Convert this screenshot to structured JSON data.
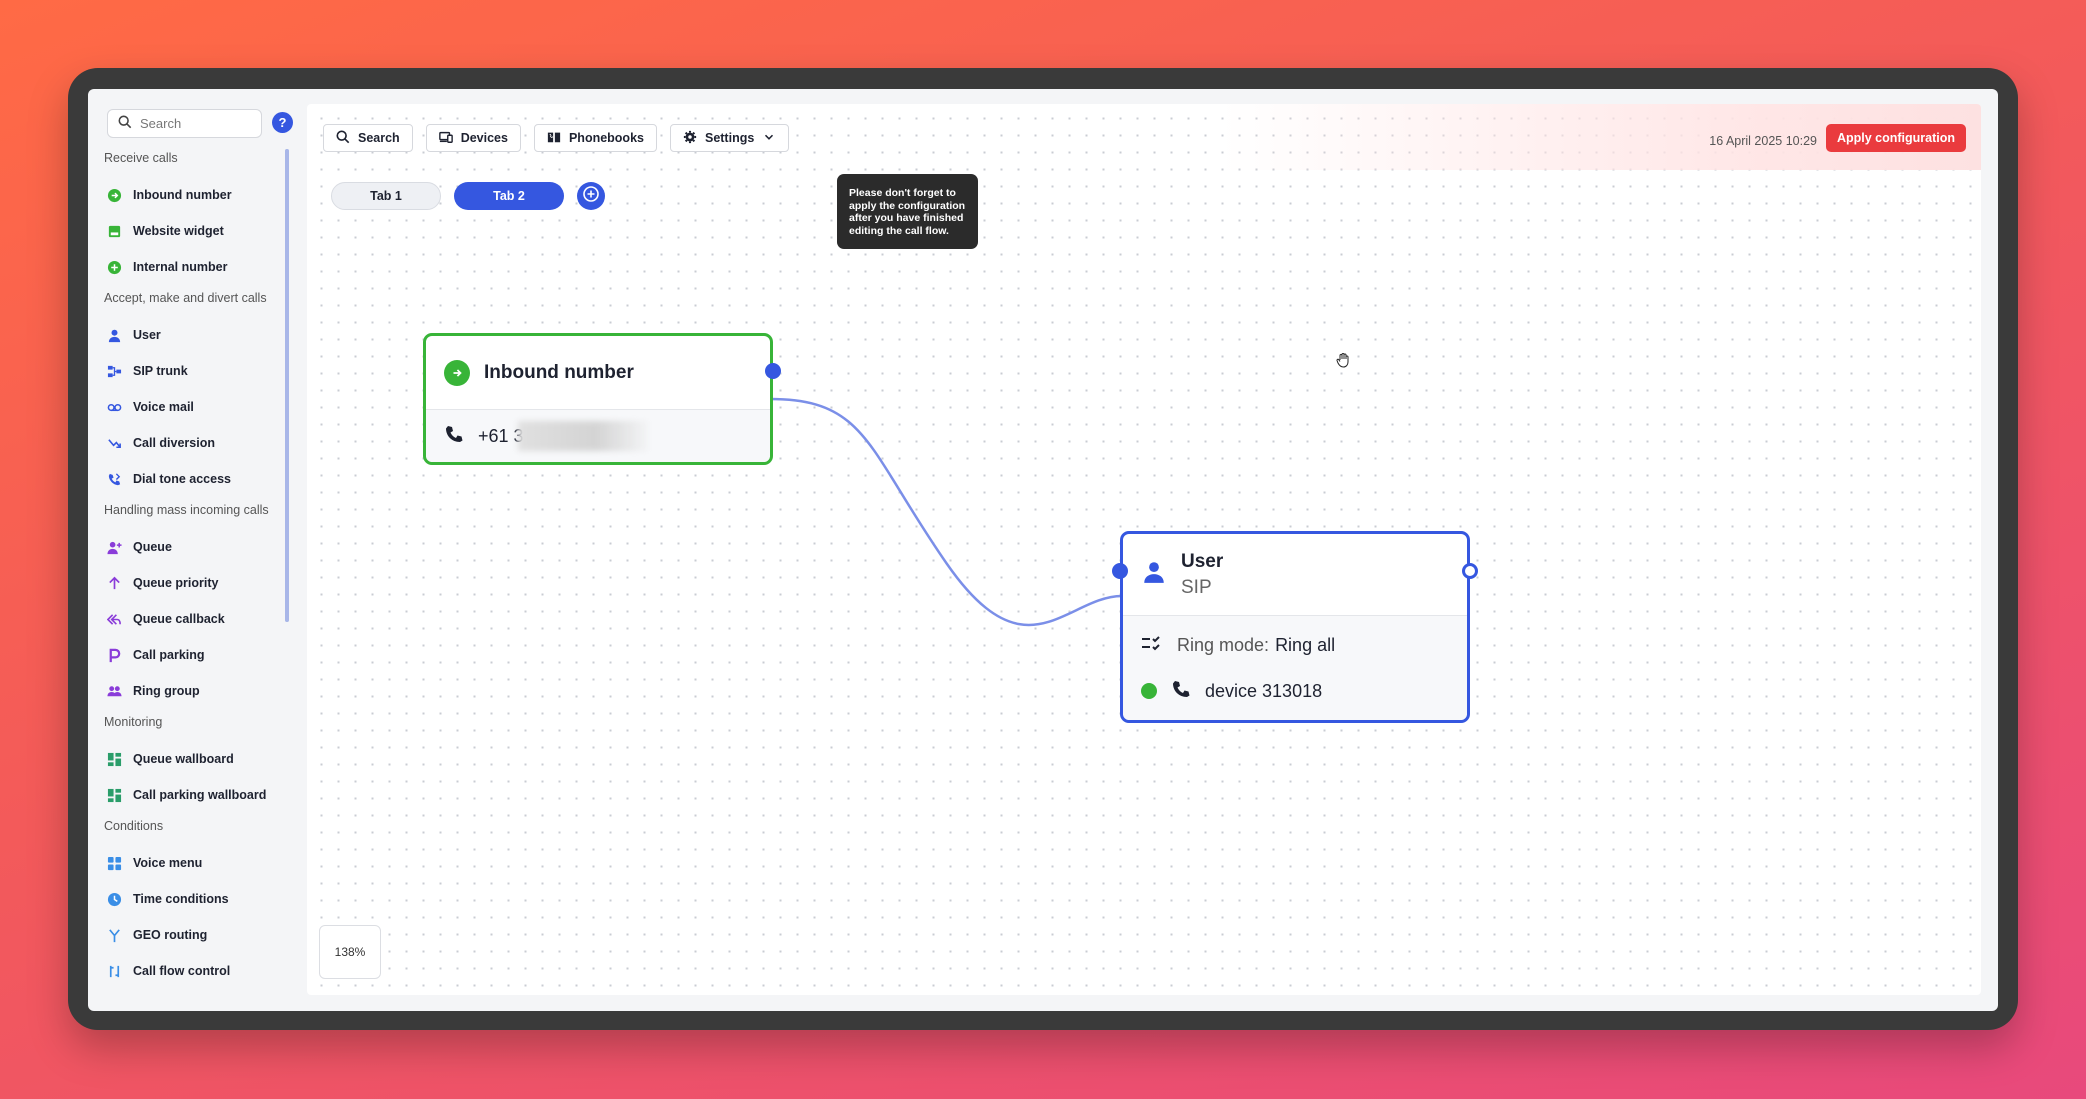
{
  "sidebar": {
    "search_placeholder": "Search",
    "help_label": "?",
    "sections": {
      "receive": "Receive calls",
      "accept": "Accept, make and divert calls",
      "mass": "Handling mass incoming calls",
      "monitoring": "Monitoring",
      "conditions": "Conditions"
    },
    "items": {
      "inbound_number": "Inbound number",
      "website_widget": "Website widget",
      "internal_number": "Internal number",
      "user": "User",
      "sip_trunk": "SIP trunk",
      "voice_mail": "Voice mail",
      "call_diversion": "Call diversion",
      "dial_tone_access": "Dial tone access",
      "queue": "Queue",
      "queue_priority": "Queue priority",
      "queue_callback": "Queue callback",
      "call_parking": "Call parking",
      "ring_group": "Ring group",
      "queue_wallboard": "Queue wallboard",
      "call_parking_wallboard": "Call parking wallboard",
      "voice_menu": "Voice menu",
      "time_conditions": "Time conditions",
      "geo_routing": "GEO routing",
      "call_flow_control": "Call flow control"
    }
  },
  "toolbar": {
    "search": "Search",
    "devices": "Devices",
    "phonebooks": "Phonebooks",
    "settings": "Settings",
    "datetime": "16 April 2025 10:29",
    "apply": "Apply configuration"
  },
  "tabs": [
    "Tab 1",
    "Tab 2"
  ],
  "active_tab": "Tab 2",
  "tooltip": "Please don't forget to apply the configuration after you have finished editing the call flow.",
  "nodes": {
    "inbound": {
      "title": "Inbound number",
      "number": "+61 3"
    },
    "user": {
      "title": "User",
      "subtitle": "SIP",
      "ring_mode_label": "Ring mode:",
      "ring_mode_value": "Ring all",
      "device": "device 313018"
    }
  },
  "zoom": "138%",
  "colors": {
    "accent": "#3557e0",
    "success": "#38b438",
    "danger": "#ea3b3e"
  }
}
